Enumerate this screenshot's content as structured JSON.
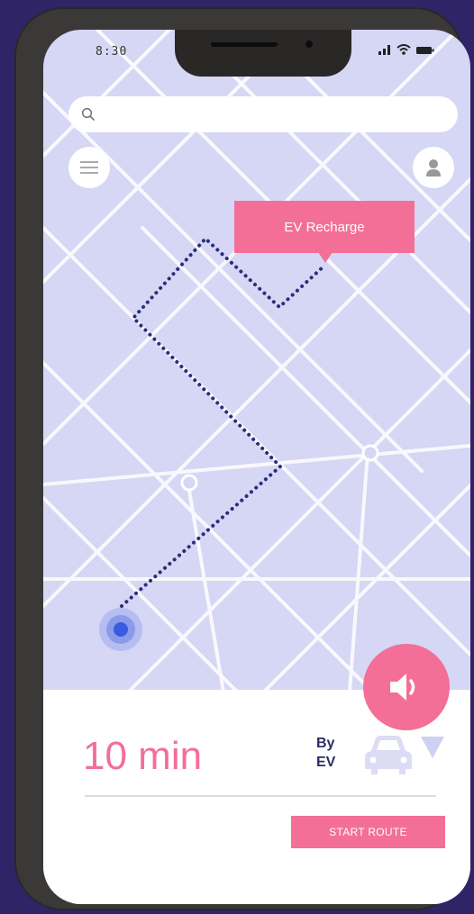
{
  "status_bar": {
    "time": "8:30"
  },
  "search": {
    "placeholder": ""
  },
  "map": {
    "callout_label": "EV Recharge"
  },
  "route_panel": {
    "eta": "10 min",
    "mode_label_line1": "By",
    "mode_label_line2": "EV",
    "start_label": "START ROUTE"
  },
  "icons": {
    "search": "search-icon",
    "menu": "hamburger-menu-icon",
    "user": "user-icon",
    "sound": "speaker-icon",
    "car": "car-icon",
    "dropdown": "triangle-down-icon",
    "location": "current-location-icon"
  },
  "colors": {
    "background": "#2e2466",
    "map": "#d6d6f5",
    "accent": "#f36f98",
    "route": "#27307a",
    "location_dot": "#3a5be0",
    "text_dark": "#2d2d66"
  }
}
